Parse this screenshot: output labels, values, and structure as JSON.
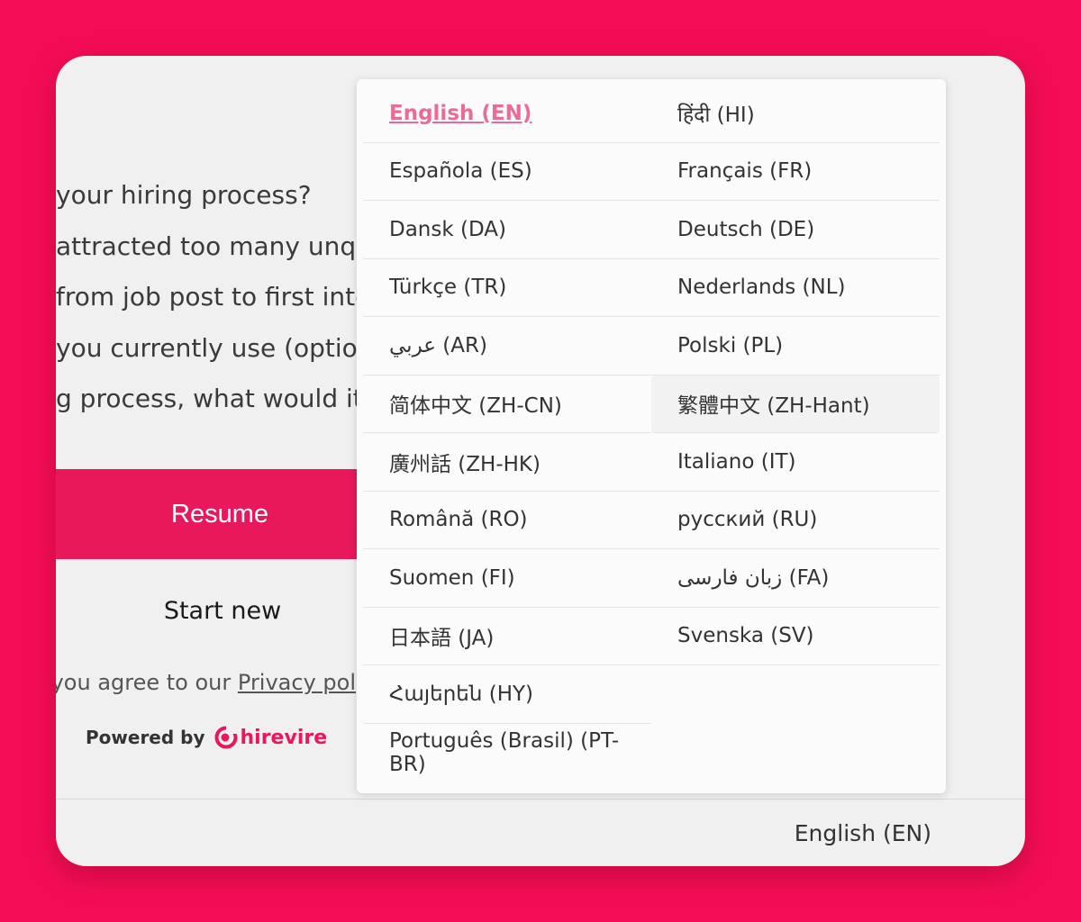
{
  "questions": [
    "your hiring process?",
    "attracted too many unqu",
    "from job post to first inte",
    "you currently use (optior",
    "g process, what would it l"
  ],
  "buttons": {
    "resume": "Resume",
    "start_new": "Start new"
  },
  "agreement": {
    "prefix": ", you agree to our ",
    "link": "Privacy pol"
  },
  "powered": {
    "label": "Powered by",
    "brand": "hirevire"
  },
  "footer": {
    "language": "English (EN)"
  },
  "languages": [
    {
      "label": "English (EN)",
      "state": "active"
    },
    {
      "label": "हिंदी (HI)"
    },
    {
      "label": "Española (ES)"
    },
    {
      "label": "Français (FR)"
    },
    {
      "label": "Dansk (DA)"
    },
    {
      "label": "Deutsch (DE)"
    },
    {
      "label": "Türkçe (TR)"
    },
    {
      "label": "Nederlands (NL)"
    },
    {
      "label": "عربي (AR)"
    },
    {
      "label": "Polski (PL)"
    },
    {
      "label": "简体中文 (ZH-CN)"
    },
    {
      "label": "繁體中文 (ZH-Hant)",
      "state": "hover"
    },
    {
      "label": "廣州話 (ZH-HK)"
    },
    {
      "label": "Italiano (IT)"
    },
    {
      "label": "Română (RO)"
    },
    {
      "label": "русский (RU)"
    },
    {
      "label": "Suomen (FI)"
    },
    {
      "label": "زبان فارسی (FA)"
    },
    {
      "label": "日本語 (JA)"
    },
    {
      "label": "Svenska (SV)"
    },
    {
      "label": "Հայերեն (HY)"
    },
    {
      "label": ""
    },
    {
      "label": "Português (Brasil) (PT-BR)"
    },
    {
      "label": ""
    }
  ],
  "colors": {
    "background": "#f40d55",
    "accent": "#e8185a",
    "active_language": "#ea6b93"
  }
}
